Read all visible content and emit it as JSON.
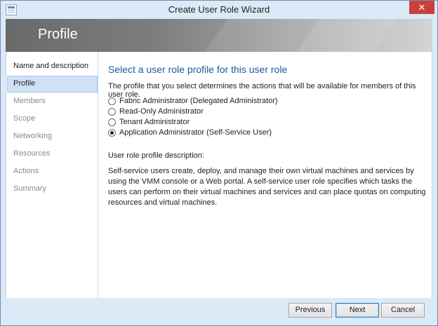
{
  "window": {
    "title": "Create User Role Wizard",
    "close_glyph": "✕"
  },
  "header": {
    "title": "Profile"
  },
  "sidebar": {
    "items": [
      {
        "label": "Name and description"
      },
      {
        "label": "Profile"
      },
      {
        "label": "Members"
      },
      {
        "label": "Scope"
      },
      {
        "label": "Networking"
      },
      {
        "label": "Resources"
      },
      {
        "label": "Actions"
      },
      {
        "label": "Summary"
      }
    ],
    "active_index": 1
  },
  "main": {
    "heading": "Select a user role profile for this user role",
    "intro": "The profile that you select determines the actions that will be available for members of this user role.",
    "options": [
      {
        "label": "Fabric Administrator (Delegated Administrator)",
        "checked": false
      },
      {
        "label": "Read-Only Administrator",
        "checked": false
      },
      {
        "label": "Tenant Administrator",
        "checked": false
      },
      {
        "label": "Application Administrator (Self-Service User)",
        "checked": true
      }
    ],
    "description_label": "User role profile description:",
    "description": "Self-service users create, deploy, and manage their own virtual machines and services by using the VMM console or a Web portal. A self-service user role specifies which tasks the users can perform on their virtual machines and services and can place quotas on computing resources and virtual machines."
  },
  "footer": {
    "previous_label": "Previous",
    "next_label": "Next",
    "cancel_label": "Cancel"
  },
  "colors": {
    "chrome": "#dce9f7",
    "heading": "#1e5aa0",
    "close": "#c7413a",
    "active_nav": "#cfe2f5"
  }
}
